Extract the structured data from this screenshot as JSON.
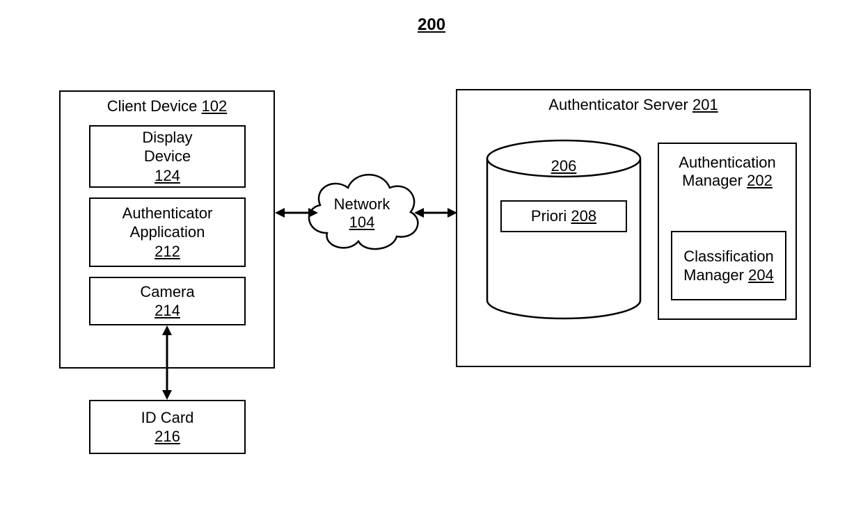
{
  "figure_number": "200",
  "client_device": {
    "title": "Client Device",
    "ref": "102",
    "display_device": {
      "label": "Display\nDevice",
      "ref": "124"
    },
    "authenticator_app": {
      "label": "Authenticator\nApplication",
      "ref": "212"
    },
    "camera": {
      "label": "Camera",
      "ref": "214"
    }
  },
  "id_card": {
    "label": "ID Card",
    "ref": "216"
  },
  "network": {
    "label": "Network",
    "ref": "104"
  },
  "auth_server": {
    "title": "Authenticator Server",
    "ref": "201",
    "database": {
      "ref": "206",
      "priori_label": "Priori",
      "priori_ref": "208"
    },
    "auth_manager": {
      "label": "Authentication\nManager",
      "ref": "202"
    },
    "class_manager": {
      "label": "Classification\nManager",
      "ref": "204"
    }
  }
}
